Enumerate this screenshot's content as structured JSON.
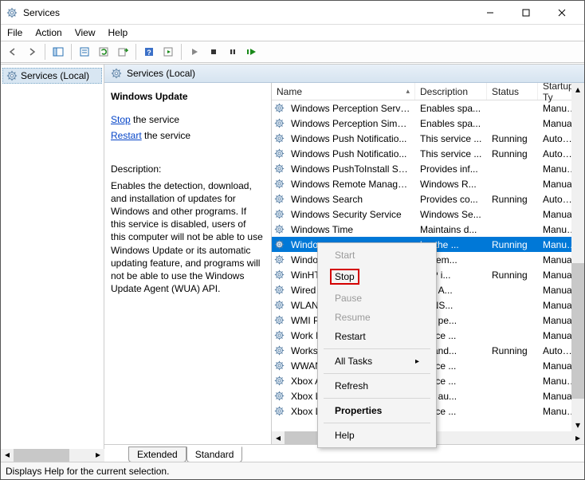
{
  "window": {
    "title": "Services"
  },
  "menubar": [
    "File",
    "Action",
    "View",
    "Help"
  ],
  "tree": {
    "root_label": "Services (Local)"
  },
  "pane": {
    "title": "Services (Local)"
  },
  "detail": {
    "heading": "Windows Update",
    "stop_link": "Stop",
    "stop_suffix": " the service",
    "restart_link": "Restart",
    "restart_suffix": " the service",
    "desc_label": "Description:",
    "description": "Enables the detection, download, and installation of updates for Windows and other programs. If this service is disabled, users of this computer will not be able to use Windows Update or its automatic updating feature, and programs will not be able to use the Windows Update Agent (WUA) API."
  },
  "columns": {
    "name": "Name",
    "description": "Description",
    "status": "Status",
    "startup": "Startup Ty"
  },
  "rows": [
    {
      "name": "Windows Perception Service",
      "desc": "Enables spa...",
      "status": "",
      "start": "Manual (T"
    },
    {
      "name": "Windows Perception Simul...",
      "desc": "Enables spa...",
      "status": "",
      "start": "Manual"
    },
    {
      "name": "Windows Push Notificatio...",
      "desc": "This service ...",
      "status": "Running",
      "start": "Automatic"
    },
    {
      "name": "Windows Push Notificatio...",
      "desc": "This service ...",
      "status": "Running",
      "start": "Automatic"
    },
    {
      "name": "Windows PushToInstall Serv...",
      "desc": "Provides inf...",
      "status": "",
      "start": "Manual (T"
    },
    {
      "name": "Windows Remote Manage...",
      "desc": "Windows R...",
      "status": "",
      "start": "Manual"
    },
    {
      "name": "Windows Search",
      "desc": "Provides co...",
      "status": "Running",
      "start": "Automatic"
    },
    {
      "name": "Windows Security Service",
      "desc": "Windows Se...",
      "status": "",
      "start": "Manual"
    },
    {
      "name": "Windows Time",
      "desc": "Maintains d...",
      "status": "",
      "start": "Manual (T"
    },
    {
      "name": "Windows",
      "desc": "les the ...",
      "status": "Running",
      "start": "Manual (T",
      "selected": true
    },
    {
      "name": "Windows",
      "desc": "es rem...",
      "status": "",
      "start": "Manual"
    },
    {
      "name": "WinHTTP",
      "desc": "TTP i...",
      "status": "Running",
      "start": "Manual"
    },
    {
      "name": "Wired Au",
      "desc": "ired A...",
      "status": "",
      "start": "Manual"
    },
    {
      "name": "WLAN A",
      "desc": "LANS...",
      "status": "",
      "start": "Manual"
    },
    {
      "name": "WMI Per",
      "desc": "des pe...",
      "status": "",
      "start": "Manual"
    },
    {
      "name": "Work Fol",
      "desc": "ervice ...",
      "status": "",
      "start": "Manual"
    },
    {
      "name": "Workstat",
      "desc": "es and...",
      "status": "Running",
      "start": "Automatic"
    },
    {
      "name": "WWAN A",
      "desc": "ervice ...",
      "status": "",
      "start": "Manual"
    },
    {
      "name": "Xbox Acc",
      "desc": "ervice ...",
      "status": "",
      "start": "Manual (T"
    },
    {
      "name": "Xbox Liv",
      "desc": "des au...",
      "status": "",
      "start": "Manual"
    },
    {
      "name": "Xbox Liv",
      "desc": "ervice ...",
      "status": "",
      "start": "Manual (T"
    }
  ],
  "tabs": {
    "extended": "Extended",
    "standard": "Standard"
  },
  "statusbar": "Displays Help for the current selection.",
  "contextmenu": {
    "start": "Start",
    "stop": "Stop",
    "pause": "Pause",
    "resume": "Resume",
    "restart": "Restart",
    "alltasks": "All Tasks",
    "refresh": "Refresh",
    "properties": "Properties",
    "help": "Help"
  }
}
